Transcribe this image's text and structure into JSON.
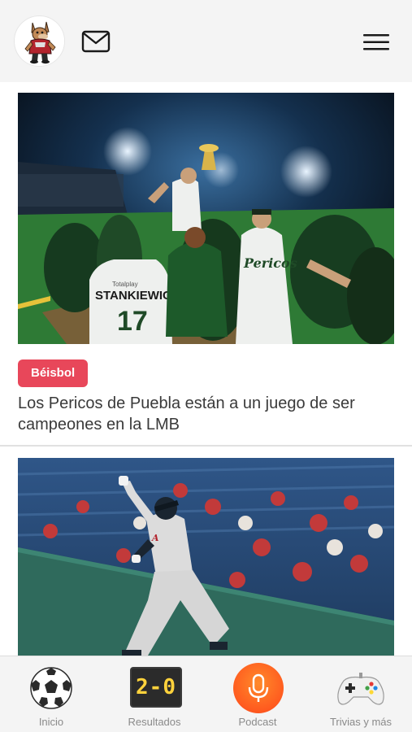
{
  "colors": {
    "tag_bg": "#e8475a",
    "header_bg": "#f4f4f4",
    "podcast_accent": "#ff5a1f",
    "score_digits": "#ffd23c"
  },
  "header": {
    "avatar_icon": "mascot-logo-icon",
    "mail_icon": "mail-icon",
    "menu_icon": "hamburger-menu-icon"
  },
  "feed": {
    "articles": [
      {
        "category": "Béisbol",
        "title": "Los Pericos de Puebla están a un juego de ser campeones en la LMB",
        "jersey_name": "STANKIEWICZ",
        "jersey_number": "17",
        "jersey_brand": "Totalplay",
        "chest_script": "Pericos"
      },
      {
        "category": "",
        "title": ""
      }
    ]
  },
  "bottom_nav": {
    "items": [
      {
        "label": "Inicio",
        "icon": "soccer-ball-icon"
      },
      {
        "label": "Resultados",
        "icon": "scoreboard-icon",
        "score": "2-0"
      },
      {
        "label": "Podcast",
        "icon": "microphone-icon"
      },
      {
        "label": "Trivias y más",
        "icon": "gamepad-icon"
      }
    ]
  }
}
